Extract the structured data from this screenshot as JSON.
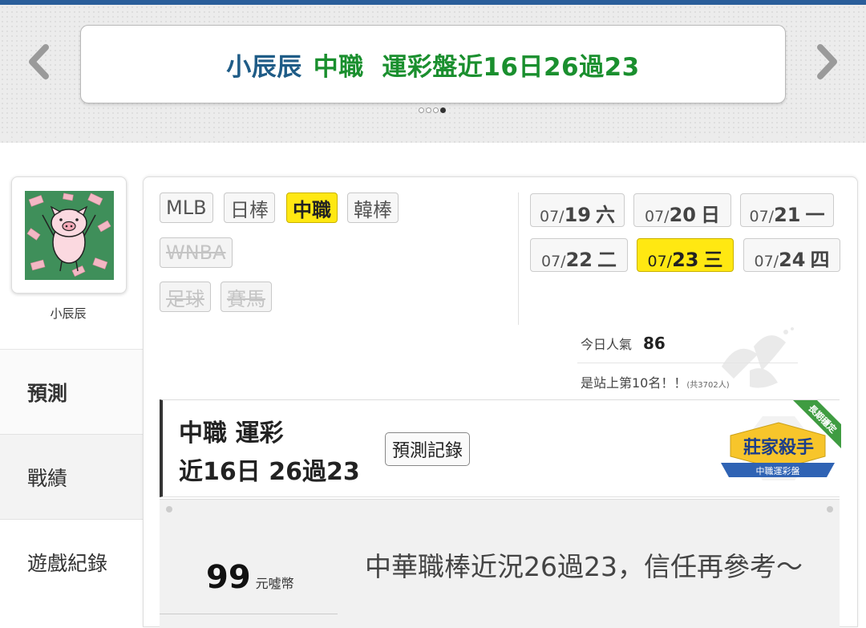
{
  "banner": {
    "author": "小辰辰",
    "headline": "中職  運彩盤近16日26過23",
    "dots": [
      false,
      false,
      false,
      true
    ]
  },
  "profile": {
    "username": "小辰辰"
  },
  "side_menu": [
    {
      "label": "預測",
      "active": true
    },
    {
      "label": "戰績",
      "active": false
    },
    {
      "label": "遊戲紀錄",
      "active": false
    }
  ],
  "leagues": [
    {
      "label": "MLB",
      "state": "normal"
    },
    {
      "label": "日棒",
      "state": "normal"
    },
    {
      "label": "中職",
      "state": "active"
    },
    {
      "label": "韓棒",
      "state": "normal"
    },
    {
      "label": "WNBA",
      "state": "disabled"
    },
    {
      "label": "足球",
      "state": "disabled"
    },
    {
      "label": "賽馬",
      "state": "disabled"
    }
  ],
  "dates": [
    {
      "md": "07/",
      "d": "19",
      "wd": "六",
      "active": false
    },
    {
      "md": "07/",
      "d": "20",
      "wd": "日",
      "active": false
    },
    {
      "md": "07/",
      "d": "21",
      "wd": "一",
      "active": false
    },
    {
      "md": "07/",
      "d": "22",
      "wd": "二",
      "active": false
    },
    {
      "md": "07/",
      "d": "23",
      "wd": "三",
      "active": true
    },
    {
      "md": "07/",
      "d": "24",
      "wd": "四",
      "active": false
    }
  ],
  "popularity": {
    "label": "今日人氣",
    "value": "86",
    "rank_text": "是站上第10名！！",
    "rank_total": "(共3702人)"
  },
  "record": {
    "line1": "中職 運彩",
    "line2": "近16日 26過23",
    "button": "預測記錄",
    "badge_title": "莊家殺手",
    "badge_sub": "中職運彩盤",
    "badge_ribbon": "長期穩定"
  },
  "offer": {
    "price": "99",
    "unit": "元噓幣",
    "message": "中華職棒近況26過23，信任再參考～"
  },
  "colors": {
    "author": "#1f5c87",
    "headline": "#1a8f2e",
    "active_tab": "#ffe812",
    "top_bar": "#2a5e9a"
  }
}
